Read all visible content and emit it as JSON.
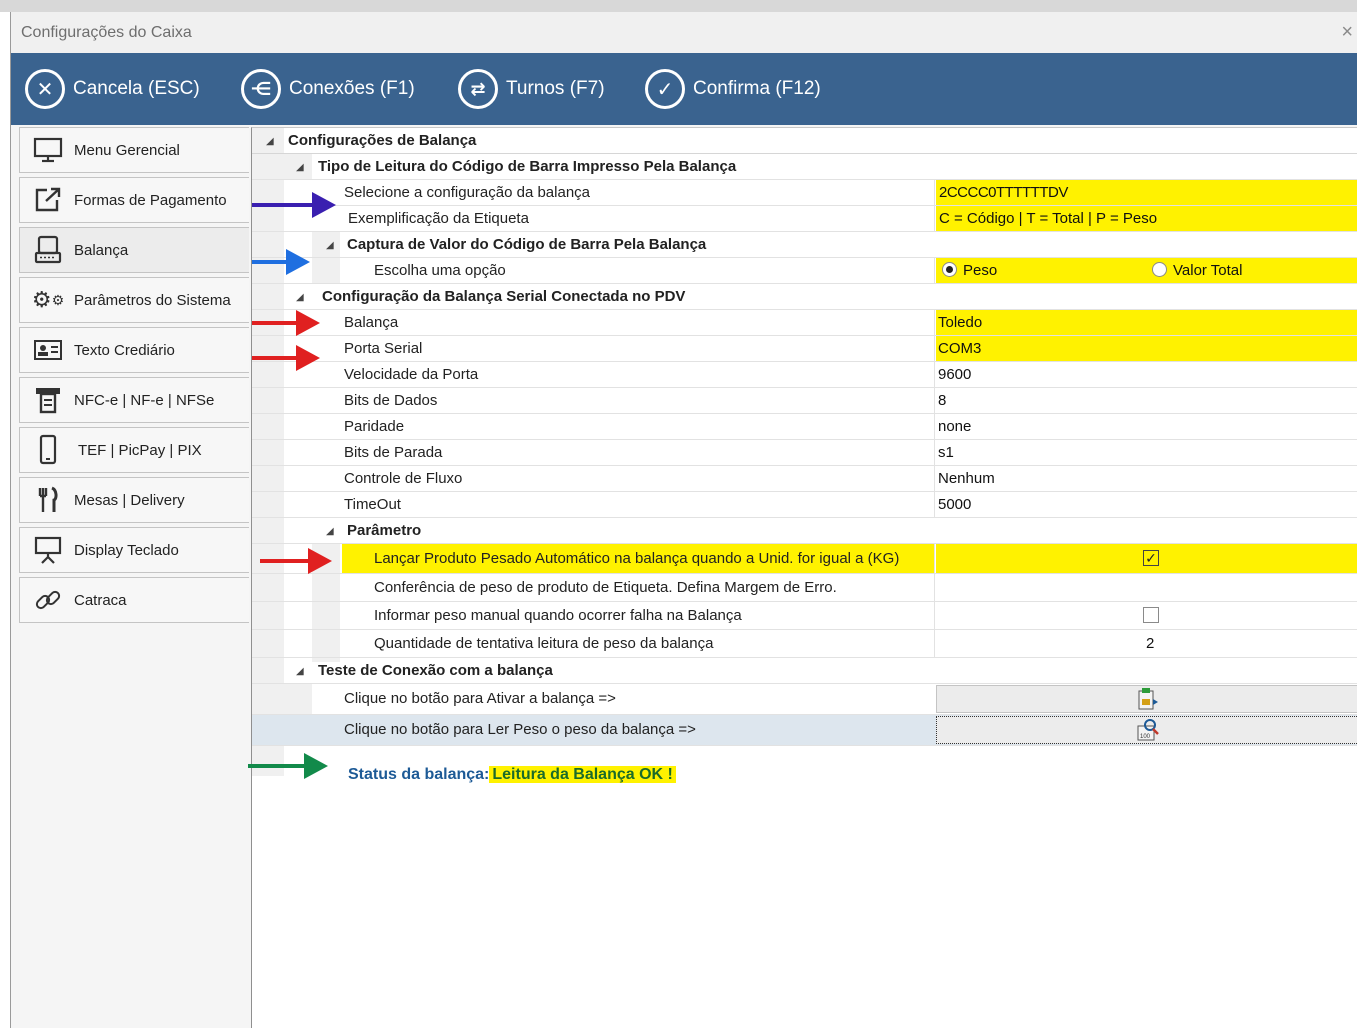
{
  "window": {
    "title": "Configurações do Caixa",
    "close": "×"
  },
  "toolbar": {
    "cancel": "Cancela (ESC)",
    "connections": "Conexões (F1)",
    "shifts": "Turnos (F7)",
    "confirm": "Confirma (F12)"
  },
  "sidebar": {
    "items": [
      {
        "label": "Menu Gerencial",
        "icon": "monitor-icon"
      },
      {
        "label": "Formas de Pagamento",
        "icon": "external-link-icon"
      },
      {
        "label": "Balança",
        "icon": "scale-icon"
      },
      {
        "label": "Parâmetros do Sistema",
        "icon": "gears-icon"
      },
      {
        "label": "Texto Crediário",
        "icon": "id-card-icon"
      },
      {
        "label": "NFC-e | NF-e | NFSe",
        "icon": "receipt-printer-icon"
      },
      {
        "label": "TEF | PicPay | PIX",
        "icon": "phone-icon"
      },
      {
        "label": "Mesas | Delivery",
        "icon": "fork-knife-icon"
      },
      {
        "label": "Display Teclado",
        "icon": "display-icon"
      },
      {
        "label": "Catraca",
        "icon": "link-icon"
      }
    ]
  },
  "grid": {
    "root": "Configurações de Balança",
    "group1": {
      "title": "Tipo de Leitura do Código de Barra Impresso Pela Balança",
      "rows": [
        {
          "label": "Selecione a configuração da balança",
          "value": "2CCCC0TTTTTTDV"
        },
        {
          "label": "Exemplificação da Etiqueta",
          "value": "C = Código | T = Total | P = Peso"
        }
      ],
      "sub": {
        "title": "Captura de Valor do Código de Barra Pela Balança",
        "label": "Escolha uma opção",
        "option1": "Peso",
        "option2": "Valor Total"
      }
    },
    "group2": {
      "title": "Configuração da Balança Serial Conectada no PDV",
      "rows": [
        {
          "label": "Balança",
          "value": "Toledo"
        },
        {
          "label": "Porta Serial",
          "value": "COM3"
        },
        {
          "label": "Velocidade da Porta",
          "value": "9600"
        },
        {
          "label": "Bits de Dados",
          "value": "8"
        },
        {
          "label": "Paridade",
          "value": "none"
        },
        {
          "label": "Bits de Parada",
          "value": "s1"
        },
        {
          "label": "Controle de Fluxo",
          "value": "Nenhum"
        },
        {
          "label": "TimeOut",
          "value": "5000"
        }
      ],
      "sub": {
        "title": "Parâmetro",
        "rows": [
          {
            "label": "Lançar Produto Pesado Automático na balança quando a Unid. for igual a (KG)",
            "checked": true
          },
          {
            "label": "Conferência de peso de produto de Etiqueta. Defina Margem de Erro."
          },
          {
            "label": "Informar peso manual quando ocorrer falha na Balança",
            "checked": false
          },
          {
            "label": "Quantidade de tentativa leitura de peso da balança",
            "value": "2"
          }
        ]
      }
    },
    "group3": {
      "title": "Teste de Conexão com a balança",
      "rows": [
        {
          "label": "Clique no botão para Ativar a balança =>"
        },
        {
          "label": "Clique no botão para Ler Peso o peso da balança =>"
        }
      ]
    },
    "status": {
      "label": "Status da balança:",
      "value": "Leitura da Balança OK !"
    }
  },
  "colors": {
    "toolbar": "#3a638f",
    "category": "#1d5a96",
    "highlight": "#fff200",
    "status_ok": "#1a6b2a",
    "arrow_red": "#e02020",
    "arrow_blue": "#1f6fe0",
    "arrow_purple": "#3a1fb0",
    "arrow_green": "#128a4a"
  }
}
